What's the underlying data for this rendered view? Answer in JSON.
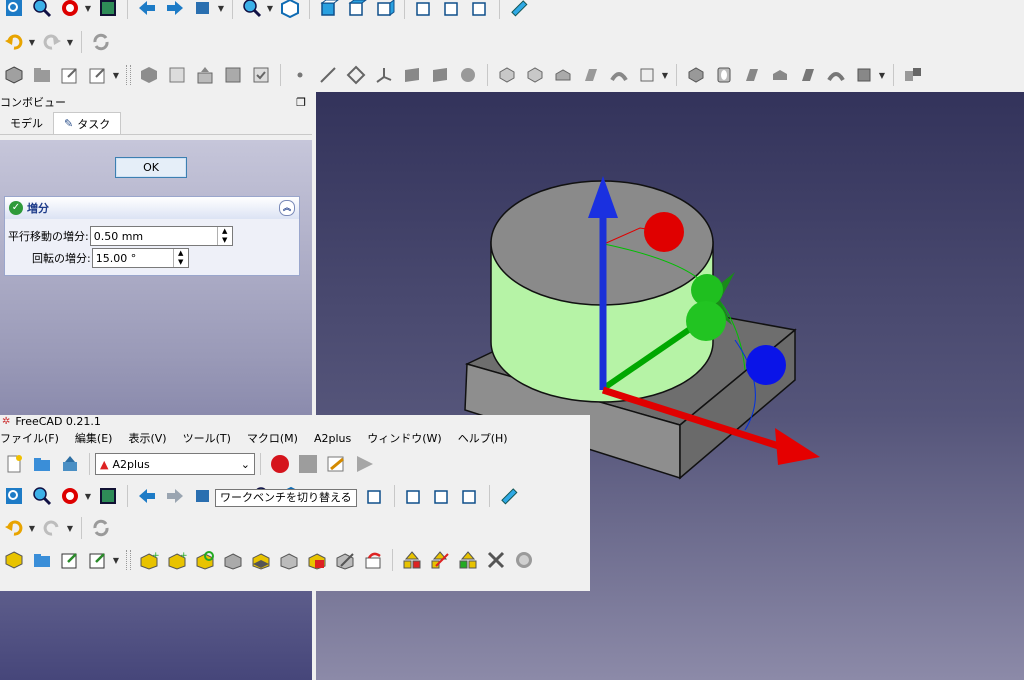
{
  "main_toolbar_1": {
    "icons": [
      "fit-all-icon",
      "zoom-icon",
      "draw-style-icon",
      "bounding-box-icon",
      "back-icon",
      "forward-icon",
      "sync-view-icon",
      "zoom-view-icon",
      "isometric-view-icon",
      "front-view-icon",
      "top-view-icon",
      "right-view-icon",
      "rear-view-icon",
      "bottom-view-icon",
      "left-view-icon",
      "measure-icon"
    ]
  },
  "main_toolbar_2": {
    "icons": [
      "undo-icon",
      "redo-icon",
      "refresh-icon"
    ]
  },
  "main_toolbar_3": {
    "icons": [
      "part-icon",
      "folder-icon",
      "export-icon",
      "share-icon",
      "make-icon",
      "new-body-icon",
      "import-icon",
      "clone-icon",
      "check-icon",
      "point-icon",
      "line-icon",
      "plane-icon",
      "lcs-icon",
      "shape-binder-icon",
      "sub-shape-binder-icon",
      "clone-feature-icon",
      "pad-icon",
      "pocket-icon",
      "revolve-icon",
      "loft-icon",
      "sweep-icon",
      "box-icon",
      "hole-icon",
      "groove-icon",
      "subtract-loft-icon",
      "subtract-sweep-icon",
      "subtract-box-icon",
      "fillet-icon"
    ]
  },
  "combo_view": {
    "title": "コンボビュー",
    "tabs": [
      {
        "label": "モデル"
      },
      {
        "label": "タスク"
      }
    ],
    "ok_label": "OK",
    "increments": {
      "title": "増分",
      "translation_label": "平行移動の増分:",
      "translation_value": "0.50 mm",
      "rotation_label": "回転の増分:",
      "rotation_value": "15.00 °"
    }
  },
  "second_window": {
    "title": "FreeCAD 0.21.1",
    "menu": [
      "ファイル(F)",
      "編集(E)",
      "表示(V)",
      "ツール(T)",
      "マクロ(M)",
      "A2plus",
      "ウィンドウ(W)",
      "ヘルプ(H)"
    ],
    "workbench": "A2plus",
    "tooltip": "ワークベンチを切り替える"
  },
  "colors": {
    "x_axis": "#e00000",
    "y_axis": "#00b000",
    "z_axis": "#0030e0",
    "selected_part": "#b6f3a6",
    "base_part": "#8a8a8a"
  }
}
